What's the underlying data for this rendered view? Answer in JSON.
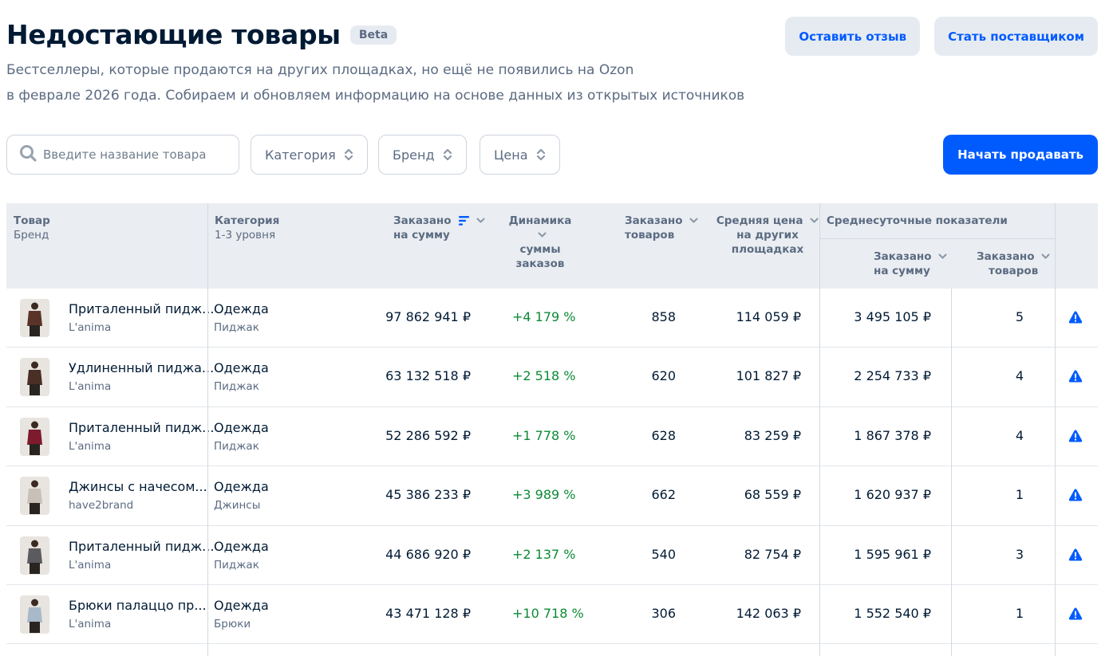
{
  "header": {
    "title": "Недостающие товары",
    "badge": "Beta",
    "subtitle_line1": "Бестселлеры, которые продаются на других площадках, но ещё не появились на Ozon",
    "subtitle_line2": "в феврале 2026 года. Собираем и обновляем информацию на основе данных из открытых источников",
    "feedback_button": "Оставить отзыв",
    "supplier_button": "Стать поставщиком"
  },
  "filters": {
    "search_placeholder": "Введите название товара",
    "category": "Категория",
    "brand": "Бренд",
    "price": "Цена",
    "start_selling": "Начать продавать"
  },
  "table": {
    "headers": {
      "product": "Товар",
      "product_sub": "Бренд",
      "category": "Категория",
      "category_sub": "1-3 уровня",
      "ordered_sum_l1": "Заказано",
      "ordered_sum_l2": "на сумму",
      "dynamics_l1": "Динамика",
      "dynamics_l2": "суммы",
      "dynamics_l3": "заказов",
      "ordered_items_l1": "Заказано",
      "ordered_items_l2": "товаров",
      "avg_price_l1": "Средняя цена",
      "avg_price_l2": "на других",
      "avg_price_l3": "площадках",
      "daily_group": "Среднесуточные показатели",
      "daily_sum_l1": "Заказано",
      "daily_sum_l2": "на сумму",
      "daily_items_l1": "Заказано",
      "daily_items_l2": "товаров"
    },
    "rows": [
      {
        "name": "Приталенный пидж...",
        "brand": "L'anima",
        "category": "Одежда",
        "subcategory": "Пиджак",
        "ordered_sum": "97 862 941 ₽",
        "dynamics": "+4 179 %",
        "ordered_items": "858",
        "avg_price": "114 059 ₽",
        "daily_sum": "3 495 105 ₽",
        "daily_items": "5",
        "thumb_color": "#5a3328"
      },
      {
        "name": "Удлиненный пиджа...",
        "brand": "L'anima",
        "category": "Одежда",
        "subcategory": "Пиджак",
        "ordered_sum": "63 132 518 ₽",
        "dynamics": "+2 518 %",
        "ordered_items": "620",
        "avg_price": "101 827 ₽",
        "daily_sum": "2 254 733 ₽",
        "daily_items": "4",
        "thumb_color": "#4a2f26"
      },
      {
        "name": "Приталенный пидж...",
        "brand": "L'anima",
        "category": "Одежда",
        "subcategory": "Пиджак",
        "ordered_sum": "52 286 592 ₽",
        "dynamics": "+1 778 %",
        "ordered_items": "628",
        "avg_price": "83 259 ₽",
        "daily_sum": "1 867 378 ₽",
        "daily_items": "4",
        "thumb_color": "#7d1a2e"
      },
      {
        "name": "Джинсы с начесом...",
        "brand": "have2brand",
        "category": "Одежда",
        "subcategory": "Джинсы",
        "ordered_sum": "45 386 233 ₽",
        "dynamics": "+3 989 %",
        "ordered_items": "662",
        "avg_price": "68 559 ₽",
        "daily_sum": "1 620 937 ₽",
        "daily_items": "1",
        "thumb_color": "#c9c1b8"
      },
      {
        "name": "Приталенный пидж...",
        "brand": "L'anima",
        "category": "Одежда",
        "subcategory": "Пиджак",
        "ordered_sum": "44 686 920 ₽",
        "dynamics": "+2 137 %",
        "ordered_items": "540",
        "avg_price": "82 754 ₽",
        "daily_sum": "1 595 961 ₽",
        "daily_items": "3",
        "thumb_color": "#5b5b5f"
      },
      {
        "name": "Брюки палаццо пр...",
        "brand": "L'anima",
        "category": "Одежда",
        "subcategory": "Брюки",
        "ordered_sum": "43 471 128 ₽",
        "dynamics": "+10 718 %",
        "ordered_items": "306",
        "avg_price": "142 063 ₽",
        "daily_sum": "1 552 540 ₽",
        "daily_items": "1",
        "thumb_color": "#a8b9c9"
      }
    ]
  },
  "colors": {
    "accent": "#005bff",
    "growth": "#0c8a36",
    "header_bg": "#eaedf1",
    "muted_text": "#5b6b82"
  },
  "icons": {
    "search": "search-icon",
    "sort_arrows": "sort-arrows-icon",
    "sort_active": "sort-active-icon",
    "chevron": "chevron-down-icon",
    "warning": "warning-triangle-icon"
  }
}
